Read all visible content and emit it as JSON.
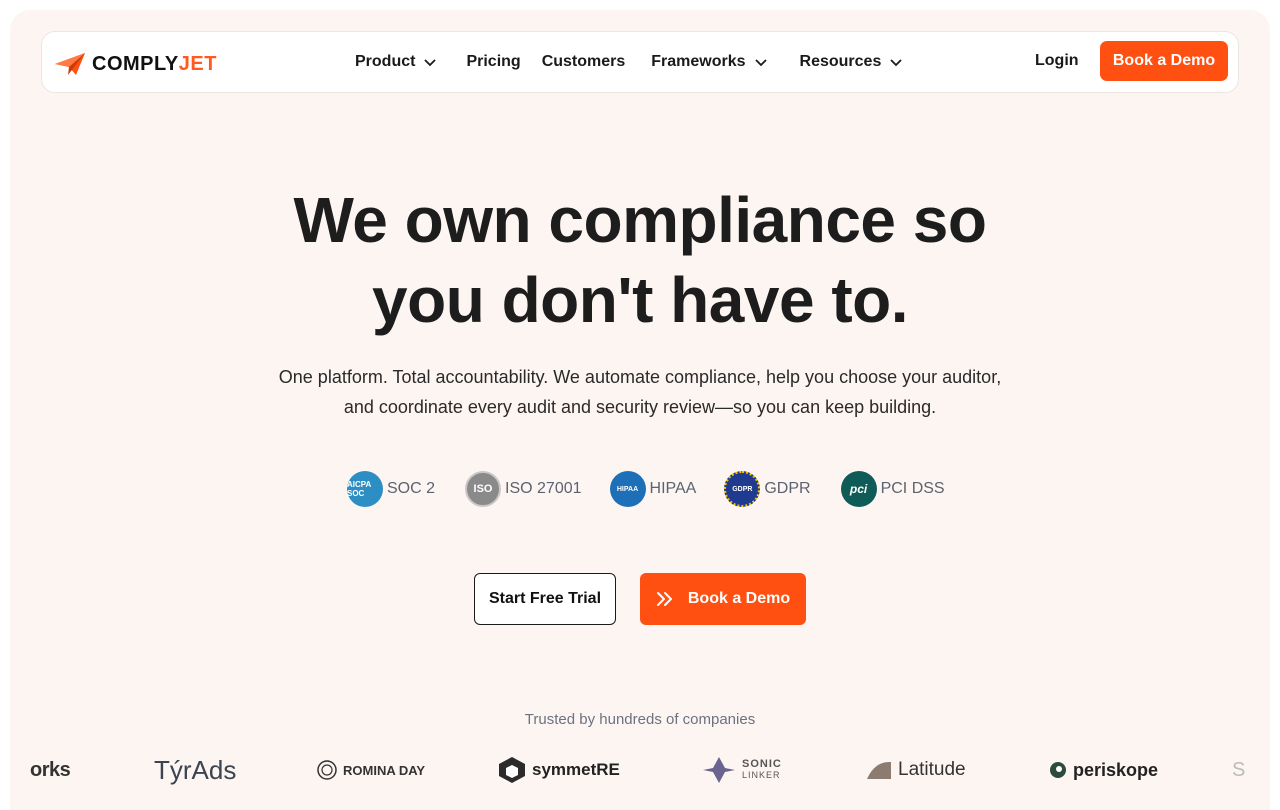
{
  "brand": {
    "logo_main": "COMPLY",
    "logo_accent": "JET",
    "accent_color": "#ff5011"
  },
  "nav": {
    "items": [
      {
        "label": "Product",
        "has_dropdown": true
      },
      {
        "label": "Pricing",
        "has_dropdown": false
      },
      {
        "label": "Customers",
        "has_dropdown": false
      },
      {
        "label": "Frameworks",
        "has_dropdown": true
      },
      {
        "label": "Resources",
        "has_dropdown": true
      }
    ],
    "login_label": "Login",
    "demo_label": "Book a Demo"
  },
  "hero": {
    "title_line1": "We own compliance so",
    "title_line2": "you don't have to.",
    "subtitle_line1": "One platform. Total accountability. We automate compliance, help you choose your auditor,",
    "subtitle_line2": "and coordinate every audit and security review—so you can keep building."
  },
  "frameworks": [
    {
      "label": "SOC 2",
      "icon": "aicpa-soc-badge",
      "icon_text": "AICPA SOC",
      "color": "#2d8ec4"
    },
    {
      "label": "ISO 27001",
      "icon": "iso-badge",
      "icon_text": "ISO",
      "color": "#8a8a8a"
    },
    {
      "label": "HIPAA",
      "icon": "hipaa-badge",
      "icon_text": "HIPAA",
      "color": "#1d6fb8"
    },
    {
      "label": "GDPR",
      "icon": "gdpr-badge",
      "icon_text": "GDPR",
      "color": "#1f3a8f"
    },
    {
      "label": "PCI DSS",
      "icon": "pci-badge",
      "icon_text": "pci",
      "color": "#0f5b57"
    }
  ],
  "cta": {
    "trial_label": "Start Free Trial",
    "demo_label": "Book a Demo"
  },
  "trusted": {
    "label": "Trusted by hundreds of companies",
    "companies": [
      "orks",
      "TýrAds",
      "ROMINA DAY",
      "symmetRE",
      "SONIC",
      "LINKER",
      "Latitude",
      "periskope",
      "S"
    ]
  }
}
